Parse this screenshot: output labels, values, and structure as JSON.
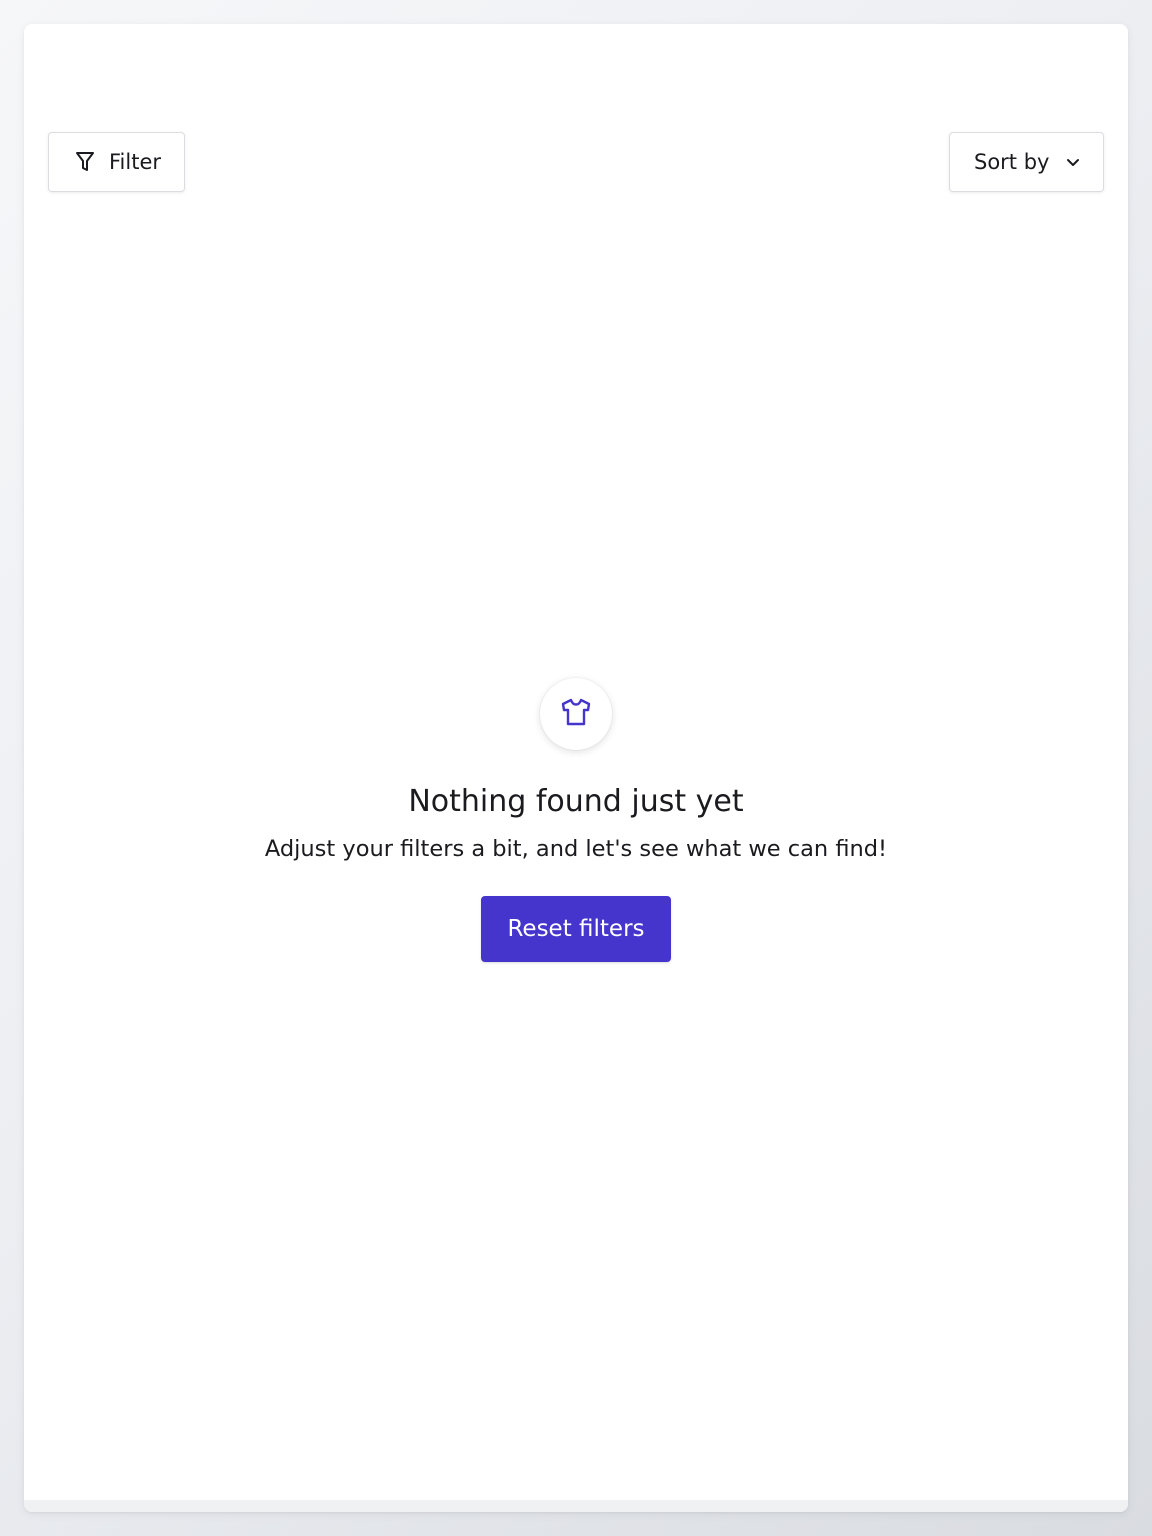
{
  "toolbar": {
    "filter_label": "Filter",
    "filter_icon": "filter-funnel-icon",
    "sort_label": "Sort by",
    "sort_icon": "chevron-down-icon"
  },
  "empty_state": {
    "icon": "shirt-icon",
    "title": "Nothing found just yet",
    "subtitle": "Adjust your filters a bit, and let's see what we can find!",
    "reset_label": "Reset filters"
  },
  "colors": {
    "accent": "#4535cc",
    "text": "#1b1b1f",
    "border": "#dcdde1",
    "page_bg": "#eceef2",
    "panel_bg": "#ffffff"
  }
}
